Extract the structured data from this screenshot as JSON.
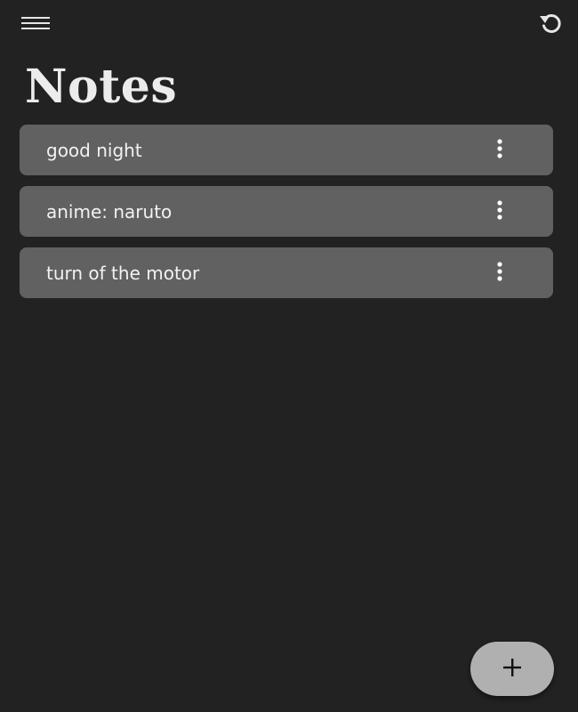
{
  "header": {
    "menu_icon": "menu-icon",
    "refresh_icon": "undo-icon"
  },
  "page": {
    "title": "Notes"
  },
  "notes": [
    {
      "text": "good night",
      "more_icon": "more-vert-icon"
    },
    {
      "text": "anime: naruto",
      "more_icon": "more-vert-icon"
    },
    {
      "text": "turn of the motor",
      "more_icon": "more-vert-icon"
    }
  ],
  "fab": {
    "icon": "plus-icon",
    "label": "+"
  },
  "colors": {
    "background": "#222222",
    "card": "#616161",
    "text": "#f2f2f2",
    "fab": "#b0b0b0"
  }
}
